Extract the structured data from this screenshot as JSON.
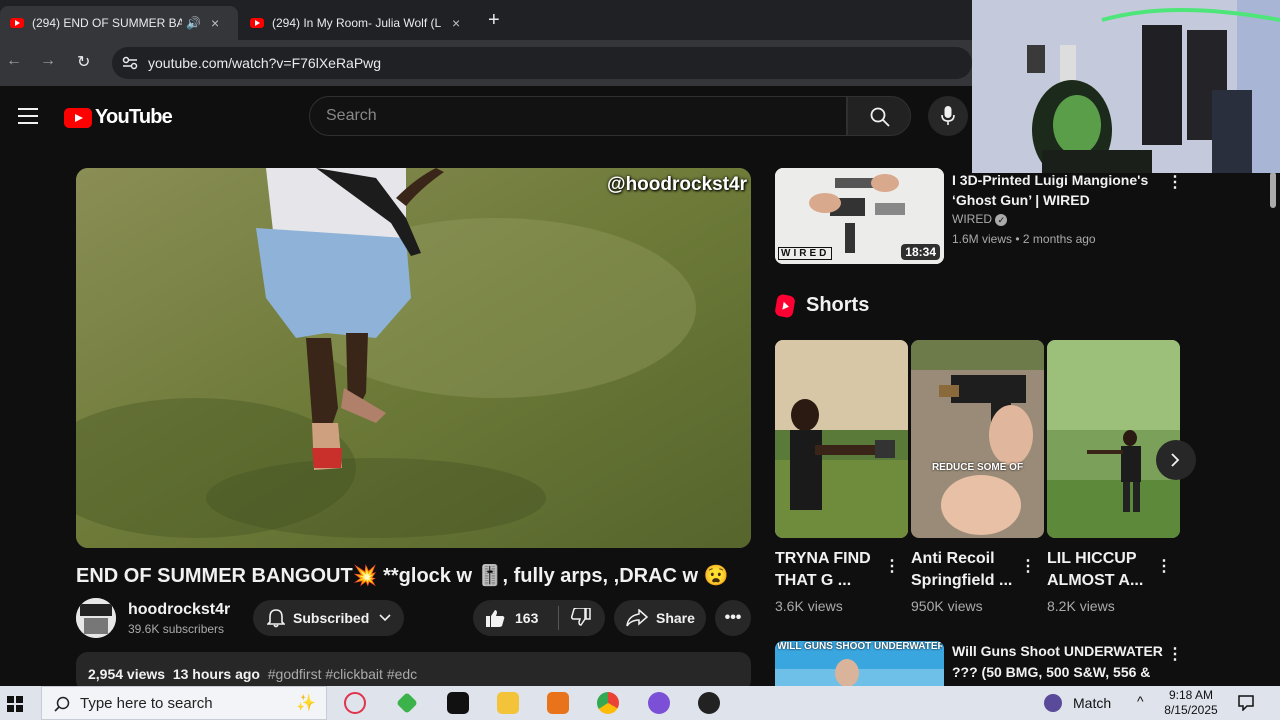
{
  "browser": {
    "tabs": [
      {
        "title": "(294) END OF SUMMER BA",
        "audio": true,
        "close": "×"
      },
      {
        "title": "(294) In My Room- Julia Wolf (L",
        "close": "×"
      }
    ],
    "new_tab": "+",
    "url": "youtube.com/watch?v=F76lXeRaPwg"
  },
  "youtube": {
    "logo_text": "YouTube",
    "search_placeholder": "Search"
  },
  "video": {
    "watermark": "@hoodrockst4r",
    "title": "END OF SUMMER BANGOUT💥 **glock w 🎚️, fully arps, ,DRAC w 😧",
    "channel": "hoodrockst4r",
    "subscribers": "39.6K subscribers",
    "subscribe_label": "Subscribed",
    "likes": "163",
    "share_label": "Share",
    "description": {
      "views": "2,954 views",
      "time": "13 hours ago",
      "tags": "#godfirst #clickbait #edc"
    }
  },
  "sidebar": {
    "rec1": {
      "title": "I 3D-Printed Luigi Mangione's ‘Ghost Gun’ | WIRED",
      "channel": "WIRED",
      "meta": "1.6M views • 2 months ago",
      "duration": "18:34",
      "thumb_brand": "WIRED"
    },
    "shorts_label": "Shorts",
    "shorts": [
      {
        "title": "TRYNA FIND\nTHAT G ...",
        "views": "3.6K views"
      },
      {
        "title": "Anti Recoil\nSpringfield ...",
        "views": "950K views",
        "overlay": "REDUCE SOME OF"
      },
      {
        "title": "LIL HICCUP\nALMOST A...",
        "views": "8.2K views"
      }
    ],
    "rec2": {
      "title": "Will Guns Shoot UNDERWATER ??? (50 BMG, 500 S&W, 556 & ...",
      "thumb_text": "WILL GUNS SHOOT UNDERWATER?"
    }
  },
  "taskbar": {
    "search_placeholder": "Type here to search",
    "weather": "Match",
    "time": "9:18 AM",
    "date": "8/15/2025"
  }
}
